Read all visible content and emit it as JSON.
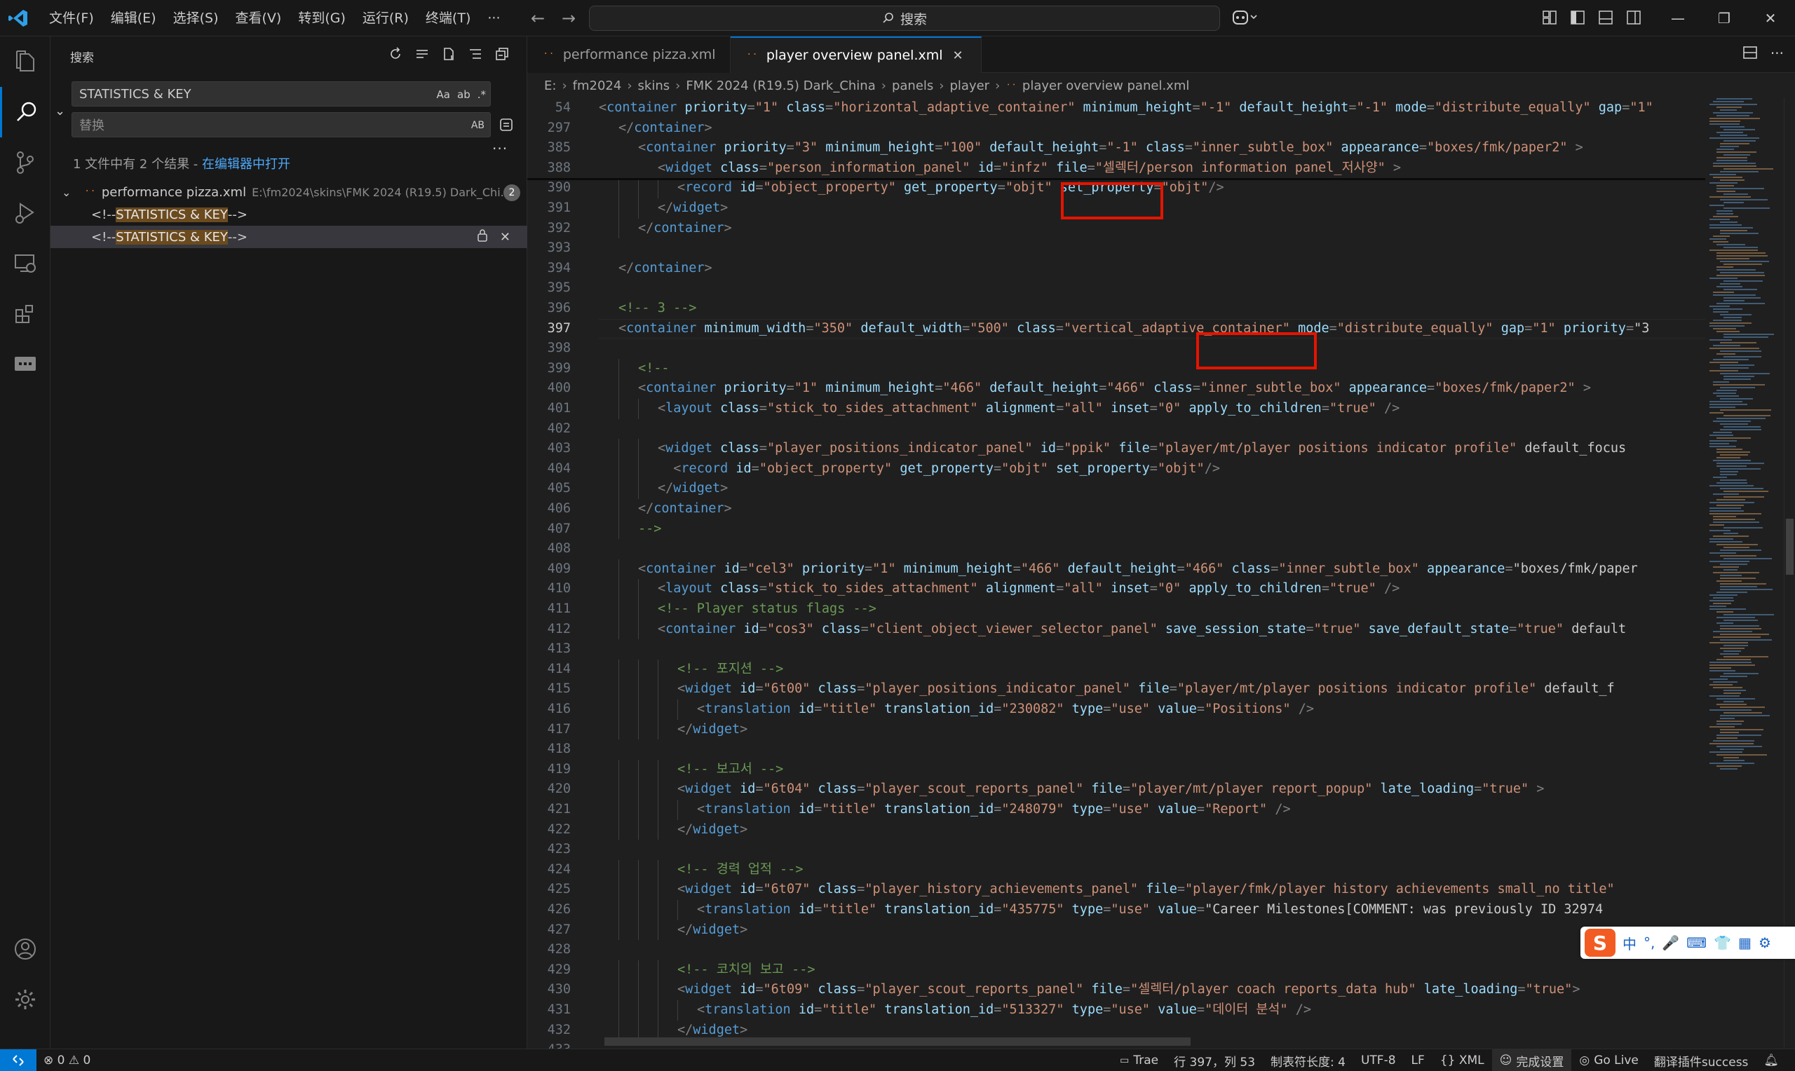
{
  "titlebar": {
    "menu": [
      "文件(F)",
      "编辑(E)",
      "选择(S)",
      "查看(V)",
      "转到(G)",
      "运行(R)",
      "终端(T)",
      "···"
    ],
    "search_placeholder": "搜索"
  },
  "sidebar": {
    "title": "搜索",
    "search_value": "STATISTICS & KEY",
    "search_opts": [
      "Aa",
      "ab",
      ".*"
    ],
    "replace_placeholder": "替换",
    "replace_opt": "AB",
    "summary_text": "1 文件中有 2 个结果 - ",
    "summary_link": "在编辑器中打开",
    "file": {
      "name": "performance pizza.xml",
      "path": "E:\\fm2024\\skins\\FMK 2024 (R19.5) Dark_Chi...",
      "count": "2"
    },
    "matches": [
      {
        "pre": "<!--",
        "hl": "STATISTICS & KEY",
        "post": "-->"
      },
      {
        "pre": "<!--",
        "hl": "STATISTICS & KEY",
        "post": "-->"
      }
    ]
  },
  "tabs": [
    {
      "label": "performance pizza.xml",
      "active": false
    },
    {
      "label": "player overview panel.xml",
      "active": true
    }
  ],
  "breadcrumb": [
    "E:",
    "fm2024",
    "skins",
    "FMK 2024 (R19.5) Dark_China",
    "panels",
    "player",
    "player overview panel.xml"
  ],
  "editor": {
    "current_line": 397,
    "lines": [
      {
        "n": "54",
        "indent": 0,
        "text": "<container priority=\"1\" class=\"horizontal_adaptive_container\" minimum_height=\"-1\" default_height=\"-1\" mode=\"distribute_equally\" gap=\"1\" "
      },
      {
        "n": "297",
        "indent": 1,
        "text": "</container>"
      },
      {
        "n": "385",
        "indent": 2,
        "text": "<container priority=\"3\" minimum_height=\"100\" default_height=\"-1\" class=\"inner_subtle_box\" appearance=\"boxes/fmk/paper2\" >"
      },
      {
        "n": "388",
        "indent": 3,
        "text": "<widget class=\"person_information_panel\" id=\"infz\" file=\"셀렉터/person information panel_저사양\" >"
      },
      {
        "n": "390",
        "indent": 4,
        "text": "<record id=\"object_property\" get_property=\"objt\" set_property=\"objt\"/>"
      },
      {
        "n": "391",
        "indent": 3,
        "text": "</widget>"
      },
      {
        "n": "392",
        "indent": 2,
        "text": "</container>"
      },
      {
        "n": "393",
        "indent": 0,
        "text": ""
      },
      {
        "n": "394",
        "indent": 1,
        "text": "</container>"
      },
      {
        "n": "395",
        "indent": 0,
        "text": ""
      },
      {
        "n": "396",
        "indent": 1,
        "text": "<!-- 3 -->"
      },
      {
        "n": "397",
        "indent": 1,
        "text": "<container minimum_width=\"350\" default_width=\"500\" class=\"vertical_adaptive_container\" mode=\"distribute_equally\" gap=\"1\" priority=\"3"
      },
      {
        "n": "398",
        "indent": 0,
        "text": ""
      },
      {
        "n": "399",
        "indent": 2,
        "text": "<!--"
      },
      {
        "n": "400",
        "indent": 2,
        "text": "<container priority=\"1\" minimum_height=\"466\" default_height=\"466\" class=\"inner_subtle_box\" appearance=\"boxes/fmk/paper2\" >"
      },
      {
        "n": "401",
        "indent": 3,
        "text": "<layout class=\"stick_to_sides_attachment\" alignment=\"all\" inset=\"0\" apply_to_children=\"true\" />"
      },
      {
        "n": "402",
        "indent": 0,
        "text": ""
      },
      {
        "n": "403",
        "indent": 3,
        "text": "<widget class=\"player_positions_indicator_panel\" id=\"ppik\" file=\"player/mt/player positions indicator profile\" default_focus"
      },
      {
        "n": "404",
        "indent": 3,
        "text": "  <record id=\"object_property\" get_property=\"objt\" set_property=\"objt\"/>"
      },
      {
        "n": "405",
        "indent": 3,
        "text": "</widget>"
      },
      {
        "n": "406",
        "indent": 2,
        "text": "</container>"
      },
      {
        "n": "407",
        "indent": 2,
        "text": "-->"
      },
      {
        "n": "408",
        "indent": 0,
        "text": ""
      },
      {
        "n": "409",
        "indent": 2,
        "text": "<container id=\"cel3\" priority=\"1\" minimum_height=\"466\" default_height=\"466\" class=\"inner_subtle_box\" appearance=\"boxes/fmk/paper"
      },
      {
        "n": "410",
        "indent": 3,
        "text": "<layout class=\"stick_to_sides_attachment\" alignment=\"all\" inset=\"0\" apply_to_children=\"true\" />"
      },
      {
        "n": "411",
        "indent": 3,
        "text": "<!-- Player status flags -->"
      },
      {
        "n": "412",
        "indent": 3,
        "text": "<container id=\"cos3\" class=\"client_object_viewer_selector_panel\" save_session_state=\"true\" save_default_state=\"true\" default"
      },
      {
        "n": "413",
        "indent": 0,
        "text": ""
      },
      {
        "n": "414",
        "indent": 4,
        "text": "<!-- 포지션 -->"
      },
      {
        "n": "415",
        "indent": 4,
        "text": "<widget id=\"6t00\" class=\"player_positions_indicator_panel\" file=\"player/mt/player positions indicator profile\" default_f"
      },
      {
        "n": "416",
        "indent": 5,
        "text": "<translation id=\"title\" translation_id=\"230082\" type=\"use\" value=\"Positions\" />"
      },
      {
        "n": "417",
        "indent": 4,
        "text": "</widget>"
      },
      {
        "n": "418",
        "indent": 0,
        "text": ""
      },
      {
        "n": "419",
        "indent": 4,
        "text": "<!-- 보고서 -->"
      },
      {
        "n": "420",
        "indent": 4,
        "text": "<widget id=\"6t04\" class=\"player_scout_reports_panel\" file=\"player/mt/player report_popup\" late_loading=\"true\" >"
      },
      {
        "n": "421",
        "indent": 5,
        "text": "<translation id=\"title\" translation_id=\"248079\" type=\"use\" value=\"Report\" />"
      },
      {
        "n": "422",
        "indent": 4,
        "text": "</widget>"
      },
      {
        "n": "423",
        "indent": 0,
        "text": ""
      },
      {
        "n": "424",
        "indent": 4,
        "text": "<!-- 경력 업적 -->"
      },
      {
        "n": "425",
        "indent": 4,
        "text": "<widget id=\"6t07\" class=\"player_history_achievements_panel\" file=\"player/fmk/player history achievements small_no title\""
      },
      {
        "n": "426",
        "indent": 5,
        "text": "<translation id=\"title\" translation_id=\"435775\" type=\"use\" value=\"Career Milestones[COMMENT: was previously ID 32974"
      },
      {
        "n": "427",
        "indent": 4,
        "text": "</widget>"
      },
      {
        "n": "428",
        "indent": 0,
        "text": ""
      },
      {
        "n": "429",
        "indent": 4,
        "text": "<!-- 코치의 보고 -->"
      },
      {
        "n": "430",
        "indent": 4,
        "text": "<widget id=\"6t09\" class=\"player_scout_reports_panel\" file=\"셀렉터/player coach reports_data hub\" late_loading=\"true\">"
      },
      {
        "n": "431",
        "indent": 5,
        "text": "<translation id=\"title\" translation_id=\"513327\" type=\"use\" value=\"데이터 분석\" />"
      },
      {
        "n": "432",
        "indent": 4,
        "text": "</widget>"
      },
      {
        "n": "433",
        "indent": 0,
        "text": ""
      }
    ]
  },
  "ime": {
    "items": [
      "中",
      "°,",
      "🎤",
      "⌨",
      "👕",
      "▦",
      "⚙"
    ]
  },
  "statusbar": {
    "problems": "⊗ 0 ⚠ 0",
    "items": [
      "Trae",
      "行 397，列 53",
      "制表符长度: 4",
      "UTF-8",
      "LF",
      "{} XML",
      "完成设置",
      "Go Live",
      "翻译插件success"
    ]
  },
  "colors": {
    "accent": "#0078d4",
    "highlight_box": "#e51400",
    "tag": "#569cd6",
    "attr": "#9cdcfe",
    "string": "#ce9178",
    "comment": "#6a9955"
  }
}
